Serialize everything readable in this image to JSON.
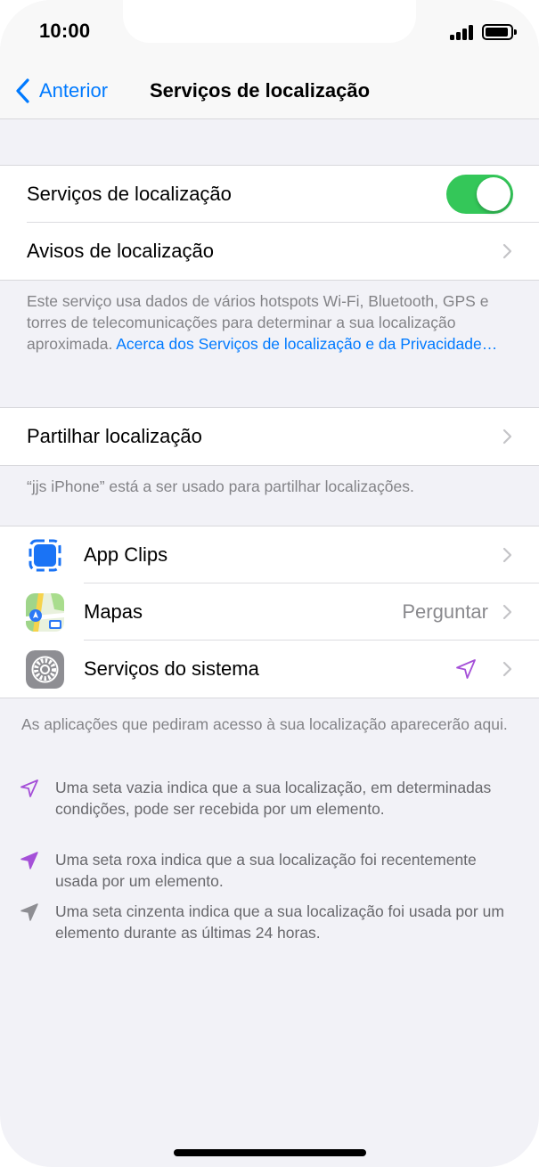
{
  "status_bar": {
    "time": "10:00"
  },
  "nav": {
    "back_label": "Anterior",
    "title": "Serviços de localização"
  },
  "location_group": {
    "services_label": "Serviços de localização",
    "services_enabled": true,
    "alerts_label": "Avisos de localização"
  },
  "info_footnote": {
    "text": "Este serviço usa dados de vários hotspots Wi-Fi, Bluetooth, GPS e torres de telecomunicações para determinar a sua localização aproximada. ",
    "link": "Acerca dos Serviços de localização e da Privacidade…"
  },
  "share_group": {
    "label": "Partilhar localização"
  },
  "share_footnote": "“jjs iPhone” está a ser usado para partilhar localizações.",
  "apps": [
    {
      "label": "App Clips",
      "icon": "app-clips-icon"
    },
    {
      "label": "Mapas",
      "value": "Perguntar",
      "icon": "maps-icon"
    },
    {
      "label": "Serviços do sistema",
      "icon": "settings-gear-icon",
      "status_icon": "location-arrow-hollow-purple"
    }
  ],
  "apps_footnote": "As aplicações que pediram acesso à sua localização aparecerão aqui.",
  "legend": [
    {
      "icon": "location-arrow-hollow-purple",
      "text": "Uma seta vazia indica que a sua localização, em determinadas condições, pode ser recebida por um elemento."
    },
    {
      "icon": "location-arrow-filled-purple",
      "text": "Uma seta roxa indica que a sua localização foi recentemente usada por um elemento."
    },
    {
      "icon": "location-arrow-filled-gray",
      "text": "Uma seta cinzenta indica que a sua localização foi usada por um elemento durante as últimas 24 horas."
    }
  ],
  "colors": {
    "accent": "#007aff",
    "toggle_on": "#34c759",
    "arrow_purple": "#a550d8",
    "arrow_gray": "#8e8e93"
  }
}
